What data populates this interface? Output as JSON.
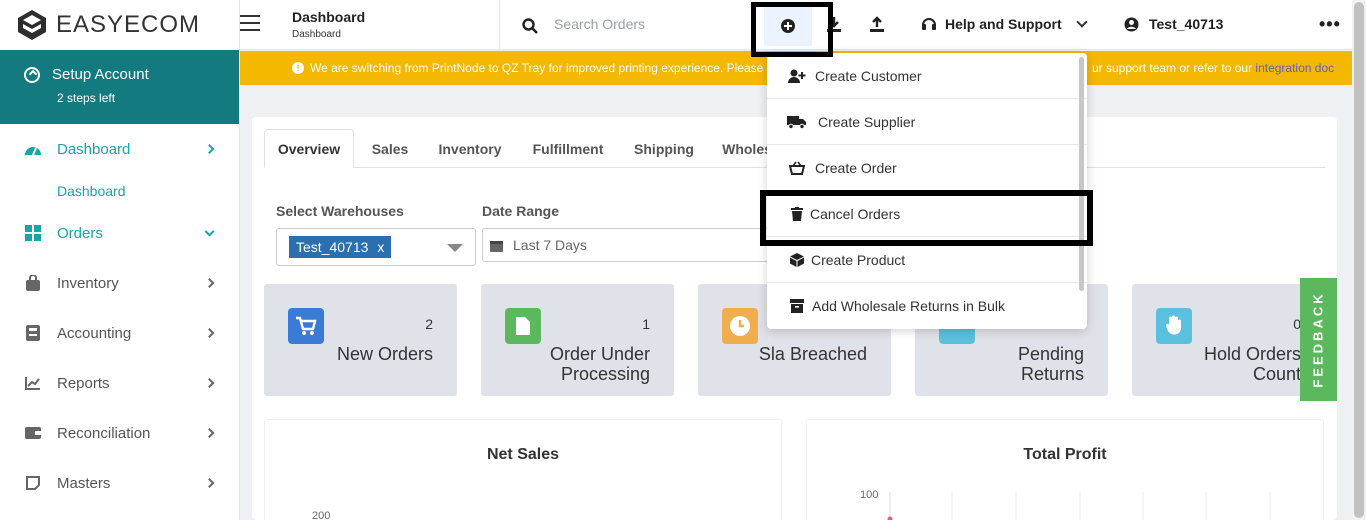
{
  "brand": {
    "name": "EASYECOM"
  },
  "setup": {
    "title": "Setup Account",
    "subtitle": "2 steps left"
  },
  "sidebar": {
    "items": [
      {
        "label": "Dashboard"
      },
      {
        "label": "Orders"
      },
      {
        "label": "Inventory"
      },
      {
        "label": "Accounting"
      },
      {
        "label": "Reports"
      },
      {
        "label": "Reconciliation"
      },
      {
        "label": "Masters"
      }
    ],
    "sub_dashboard": "Dashboard"
  },
  "header": {
    "title": "Dashboard",
    "breadcrumb": "Dashboard",
    "search_placeholder": "Search Orders",
    "help_label": "Help and Support",
    "user_label": "Test_40713",
    "more_label": "•••"
  },
  "banner": {
    "text_left": "We are switching from PrintNode to QZ Tray for improved printing experience. Please u",
    "text_right": "ur support team or refer to our ",
    "link": "integration doc"
  },
  "tabs": [
    "Overview",
    "Sales",
    "Inventory",
    "Fulfillment",
    "Shipping",
    "Wholes"
  ],
  "filters": {
    "warehouse_label": "Select Warehouses",
    "warehouse_chip": "Test_40713",
    "chip_remove": "x",
    "date_label": "Date Range",
    "date_value": "Last 7 Days"
  },
  "stats": [
    {
      "value": "2",
      "title": "New Orders"
    },
    {
      "value": "1",
      "title": "Order Under Processing"
    },
    {
      "value": "",
      "title": "Sla Breached"
    },
    {
      "value": "",
      "title": "Pending Returns"
    },
    {
      "value": "0",
      "title": "Hold Orders Count"
    }
  ],
  "charts": {
    "net_sales_title": "Net Sales",
    "net_sales_tick": "200",
    "profit_title": "Total Profit",
    "profit_tick": "100"
  },
  "dropdown": {
    "items": [
      {
        "label": "Create Customer",
        "icon": "user-plus-icon"
      },
      {
        "label": "Create Supplier",
        "icon": "truck-icon"
      },
      {
        "label": "Create Order",
        "icon": "basket-icon"
      },
      {
        "label": "Cancel Orders",
        "icon": "trash-icon"
      },
      {
        "label": "Create Product",
        "icon": "cube-icon"
      },
      {
        "label": "Add Wholesale Returns in Bulk",
        "icon": "archive-icon"
      }
    ]
  },
  "feedback": {
    "label": "FEEDBACK"
  },
  "colors": {
    "teal": "#137a7f",
    "accent": "#1aa3a8",
    "banner": "#f5b800",
    "feedback": "#5cb85c",
    "chip": "#2a6fb0"
  }
}
